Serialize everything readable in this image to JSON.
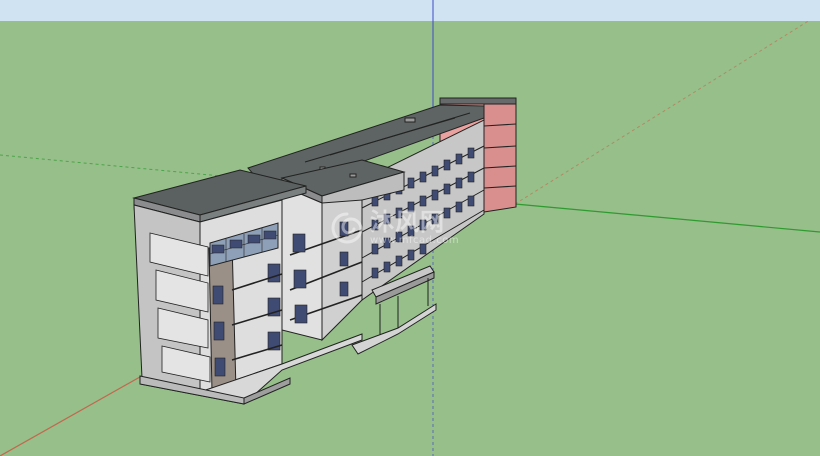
{
  "app": {
    "view": "3D model viewport"
  },
  "colors": {
    "sky": "#d0e3f3",
    "ground": "#96bf8a",
    "axis_red": "#c2684f",
    "axis_green": "#2f9a2f",
    "axis_blue": "#3e4bc8",
    "roof": "#5d6463",
    "wall_light": "#dcdcdc",
    "wall_mid": "#bdbdbd",
    "wall_dark": "#8a8c8d",
    "window": "#404b73",
    "accent_pink": "#e9a2a0",
    "outline": "#222222",
    "watermark": "#ffffff"
  },
  "icons": {
    "watermark_logo": "swirl-logo-icon"
  },
  "watermark": {
    "title": "沐风网",
    "subtitle": "www.mfcad.com"
  }
}
